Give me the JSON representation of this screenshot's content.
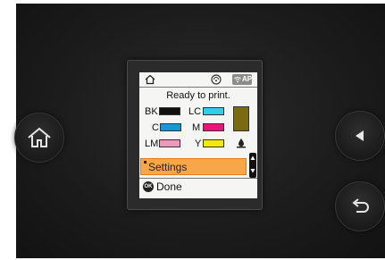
{
  "device": {
    "left_buttons": [
      {
        "icon": "home-icon"
      }
    ],
    "right_buttons": [
      {
        "icon": "left-triangle-icon"
      },
      {
        "icon": "back-arrow-icon"
      }
    ]
  },
  "screen": {
    "header": {
      "home_icon": "home-icon",
      "wifi_icon": "wifi-direct-icon",
      "ap_badge": "AP"
    },
    "status": "Ready to print.",
    "inks": [
      {
        "code": "BK",
        "color": "#111111"
      },
      {
        "code": "LC",
        "color": "#33ccee"
      },
      {
        "code": "C",
        "color": "#1199dd"
      },
      {
        "code": "M",
        "color": "#ee1177"
      },
      {
        "code": "LM",
        "color": "#ee99bb"
      },
      {
        "code": "Y",
        "color": "#f2ea00"
      }
    ],
    "maintenance_box_color": "#7a6a12",
    "menu": {
      "selected_item": "Settings"
    },
    "footer": {
      "ok_badge": "OK",
      "done_label": "Done"
    },
    "accent": "#f7a64a"
  }
}
